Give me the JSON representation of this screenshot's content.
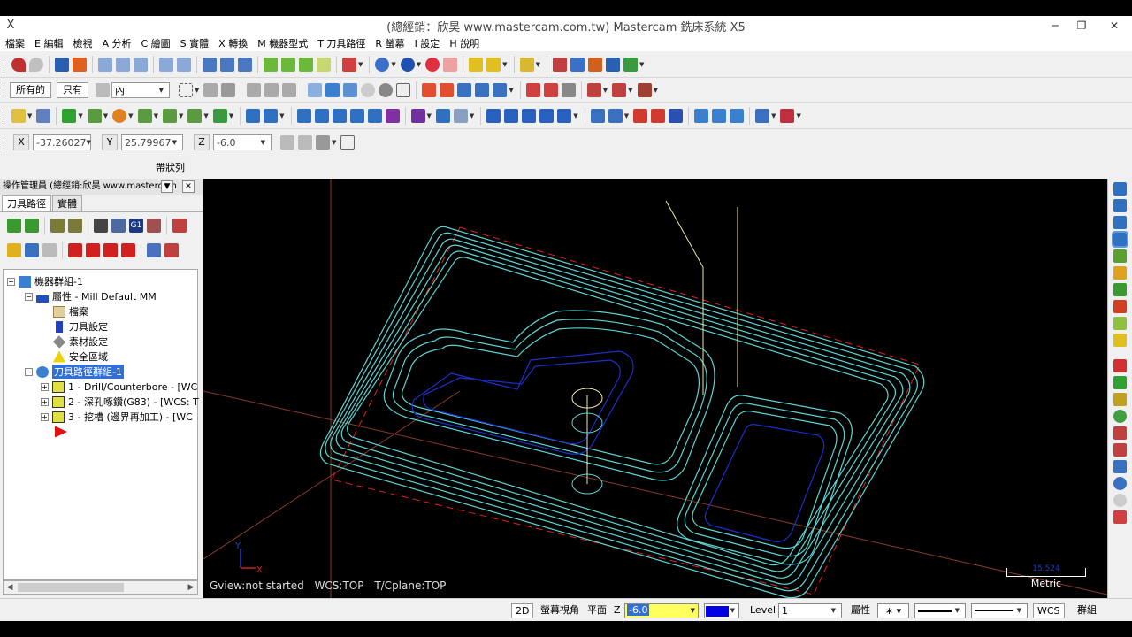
{
  "window": {
    "title": "(總經銷：欣昊 www.mastercam.com.tw) Mastercam 銑床系統 X5",
    "app_icon": "X",
    "minimize": "─",
    "restore": "❐",
    "close": "✕"
  },
  "menu": [
    "檔案",
    "E 編輯",
    "檢視",
    "A 分析",
    "C 繪圖",
    "S 實體",
    "X 轉換",
    "M 機器型式",
    "T 刀具路徑",
    "R 螢幕",
    "I 設定",
    "H 說明"
  ],
  "toolbar3": {
    "all_label": "所有的",
    "only_label": "只有",
    "inside_value": "內"
  },
  "coords": {
    "x_label": "X",
    "x_value": "-37.26027",
    "y_label": "Y",
    "y_value": "25.79967",
    "z_label": "Z",
    "z_value": "-6.0"
  },
  "ribbon_label": "帶狀列",
  "ops_manager": {
    "title": "操作管理員 (總經銷:欣昊 www.mastercam",
    "tabs": [
      "刀具路徑",
      "實體"
    ],
    "tree": {
      "machine_group": "機器群組-1",
      "properties": "屬性 - Mill Default MM",
      "files": "檔案",
      "tool_settings": "刀具設定",
      "stock_setup": "素材設定",
      "safety_zone": "安全區域",
      "toolpath_group": "刀具路徑群組-1",
      "op1": "1 - Drill/Counterbore - [WC",
      "op2": "2 - 深孔啄鑽(G83) - [WCS: T",
      "op3": "3 - 挖槽 (邊界再加工) - [WC"
    }
  },
  "viewport": {
    "gview": "Gview:not started",
    "wcs": "WCS:TOP",
    "tcplane": "T/Cplane:TOP",
    "scale_value": "15.524",
    "scale_unit": "Metric",
    "axis_y": "Y",
    "axis_x": "X"
  },
  "statusbar": {
    "mode_2d": "2D",
    "screen_view": "螢幕視角",
    "plane": "平面",
    "z_label": "Z",
    "z_value": "-6.0",
    "level_label": "Level",
    "level_value": "1",
    "attributes": "屬性",
    "wcs": "WCS",
    "group": "群組"
  },
  "colors": {
    "toolpath": "#5fd3d3",
    "geometry_blue": "#1c2ec8",
    "viewport_bg": "#000000",
    "highlight": "#3060d0"
  }
}
